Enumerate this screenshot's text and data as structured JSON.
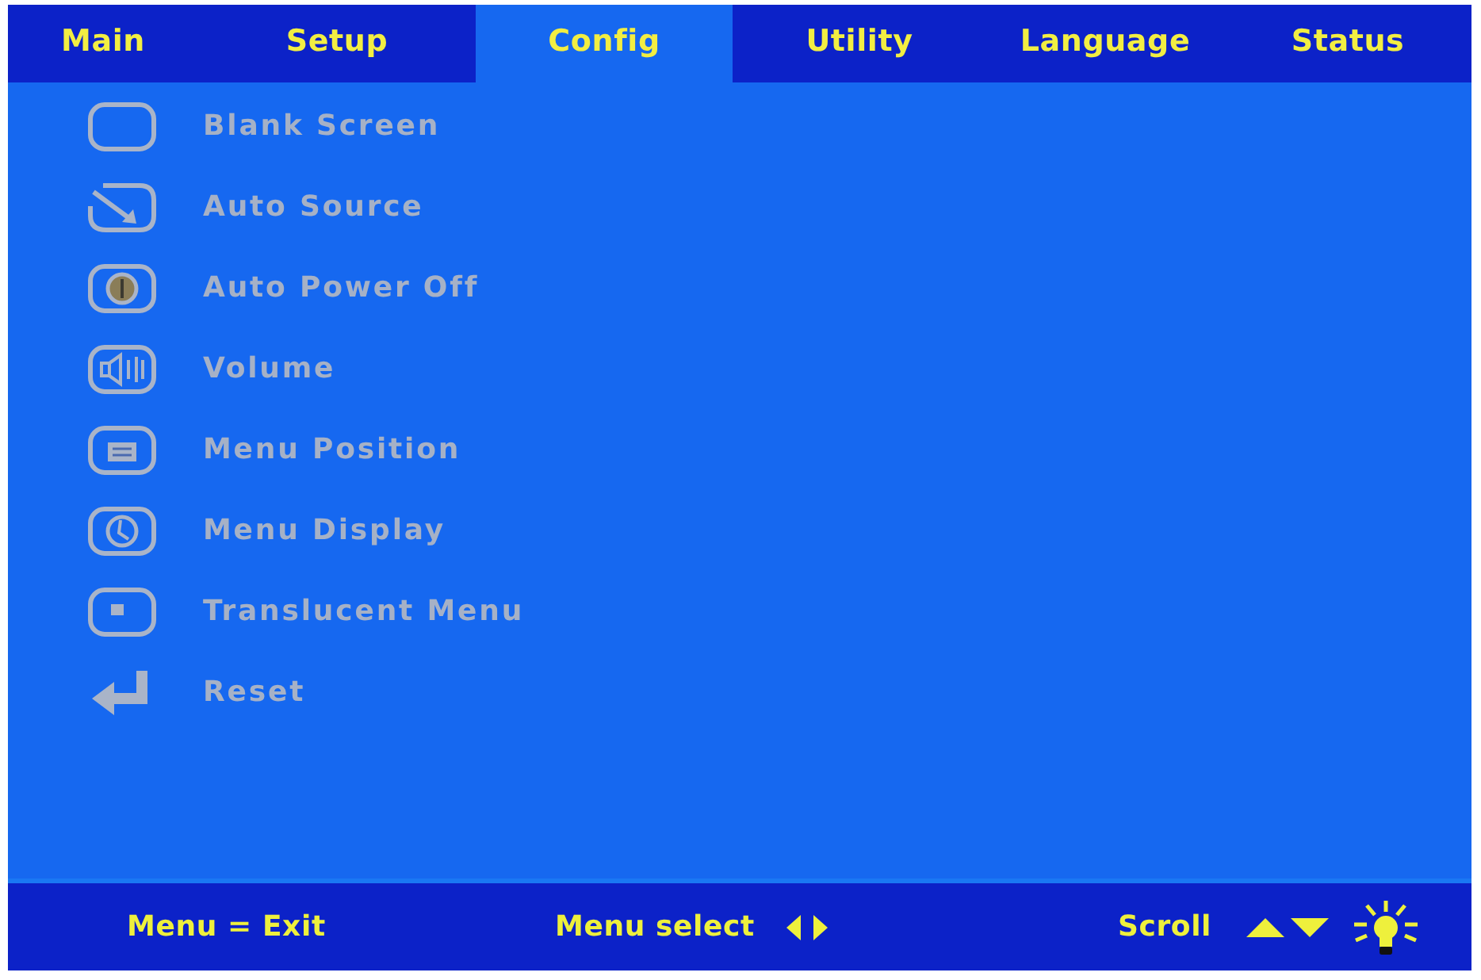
{
  "tabs": [
    {
      "label": "Main",
      "selected": false
    },
    {
      "label": "Setup",
      "selected": false
    },
    {
      "label": "Config",
      "selected": true
    },
    {
      "label": "Utility",
      "selected": false
    },
    {
      "label": "Language",
      "selected": false
    },
    {
      "label": "Status",
      "selected": false
    }
  ],
  "menu_items": [
    {
      "label": "Blank Screen",
      "kind": "blank"
    },
    {
      "label": "Auto Source",
      "kind": "source"
    },
    {
      "label": "Auto Power Off",
      "kind": "power"
    },
    {
      "label": "Volume",
      "kind": "volume"
    },
    {
      "label": "Menu Position",
      "kind": "position"
    },
    {
      "label": "Menu Display",
      "kind": "display"
    },
    {
      "label": "Translucent Menu",
      "kind": "translucent"
    },
    {
      "label": "Reset",
      "kind": "reset"
    }
  ],
  "footer": {
    "hints": [
      {
        "label": "Menu = Exit",
        "kind": "plain"
      },
      {
        "label": "Menu select",
        "kind": "left_right"
      },
      {
        "label": "Scroll",
        "kind": "up_down"
      }
    ]
  }
}
